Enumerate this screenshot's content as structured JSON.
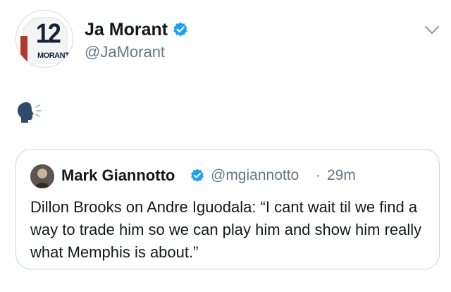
{
  "author": {
    "display_name": "Ja Morant",
    "handle": "@JaMorant",
    "jersey_number": "12",
    "jersey_name": "MORANT"
  },
  "tweet": {
    "emoji_icon": "speaking-head-icon"
  },
  "quoted_tweet": {
    "display_name": "Mark Giannotto",
    "handle": "@mgiannotto",
    "separator": "·",
    "time": "29m",
    "text": "Dillon Brooks on Andre Iguodala: “I cant wait til we find a way to trade him so we can play him and show him really what Memphis is about.”"
  },
  "colors": {
    "verified_blue": "#1da1f2",
    "secondary_text": "#657786",
    "border": "#ccd6dd"
  }
}
